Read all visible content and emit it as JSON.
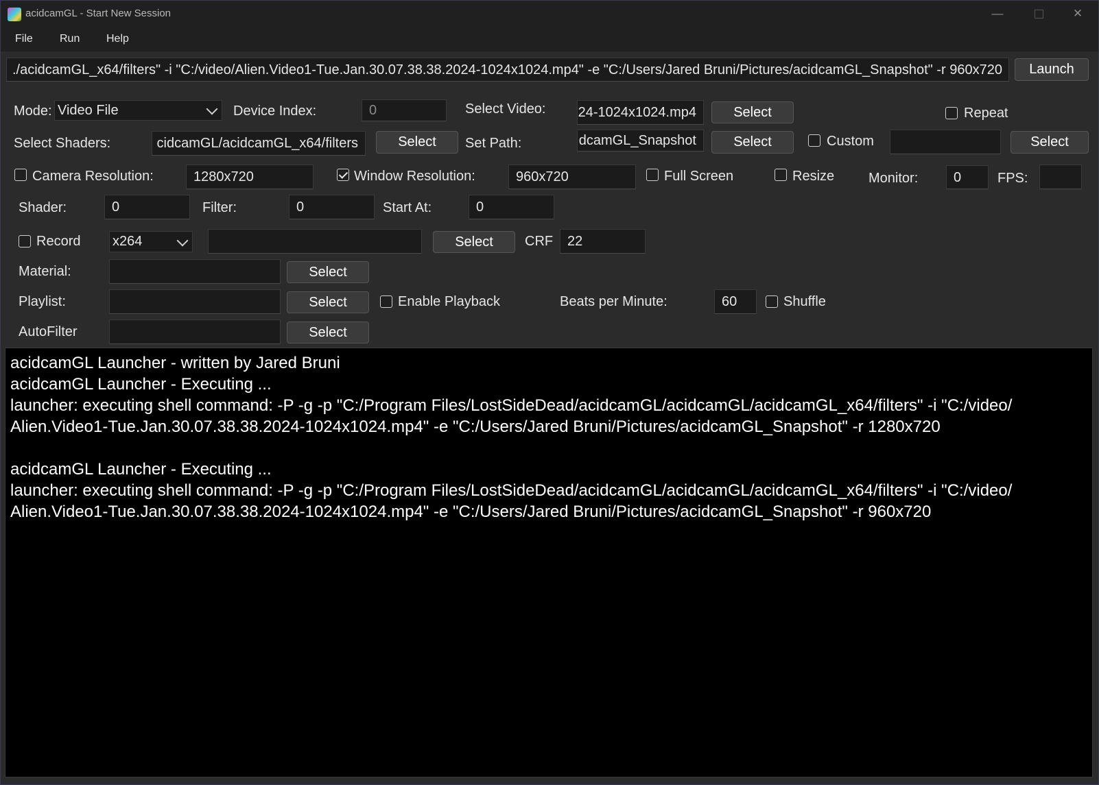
{
  "window": {
    "title": "acidcamGL - Start New Session",
    "minimize": "—",
    "close": "✕"
  },
  "menu": {
    "file": "File",
    "run": "Run",
    "help": "Help"
  },
  "command": {
    "value": "./acidcamGL_x64/filters\" -i \"C:/video/Alien.Video1-Tue.Jan.30.07.38.38.2024-1024x1024.mp4\" -e \"C:/Users/Jared Bruni/Pictures/acidcamGL_Snapshot\" -r 960x720",
    "launch_label": "Launch"
  },
  "row1": {
    "mode_label": "Mode:",
    "mode_value": "Video File",
    "device_index_label": "Device Index:",
    "device_index_value": "0",
    "select_video_label": "Select Video:",
    "select_video_value": "24-1024x1024.mp4",
    "select_label": "Select",
    "repeat_label": "Repeat"
  },
  "row2": {
    "select_shaders_label": "Select Shaders:",
    "shaders_value": "cidcamGL/acidcamGL_x64/filters",
    "select_label": "Select",
    "set_path_label": "Set Path:",
    "path_value": "dcamGL_Snapshot",
    "custom_label": "Custom",
    "custom_value": ""
  },
  "row3": {
    "camera_resolution_label": "Camera Resolution:",
    "camera_resolution_value": "1280x720",
    "window_resolution_label": "Window Resolution:",
    "window_resolution_value": "960x720",
    "full_screen_label": "Full Screen",
    "resize_label": "Resize",
    "monitor_label": "Monitor:",
    "monitor_value": "0",
    "fps_label": "FPS:",
    "fps_value": ""
  },
  "row4": {
    "shader_label": "Shader:",
    "shader_value": "0",
    "filter_label": "Filter:",
    "filter_value": "0",
    "start_at_label": "Start At:",
    "start_at_value": "0"
  },
  "row5": {
    "record_label": "Record",
    "codec_value": "x264",
    "record_path_value": "",
    "select_label": "Select",
    "crf_label": "CRF",
    "crf_value": "22"
  },
  "row6": {
    "material_label": "Material:",
    "material_value": "",
    "select_label": "Select"
  },
  "row7": {
    "playlist_label": "Playlist:",
    "playlist_value": "",
    "select_label": "Select",
    "enable_playback_label": "Enable Playback",
    "bpm_label": "Beats per Minute:",
    "bpm_value": "60",
    "shuffle_label": "Shuffle"
  },
  "row8": {
    "autofilter_label": "AutoFilter",
    "autofilter_value": "",
    "select_label": "Select"
  },
  "console": {
    "lines": [
      "acidcamGL Launcher - written by Jared Bruni",
      "acidcamGL Launcher - Executing ...",
      "launcher: executing shell command: -P -g -p \"C:/Program Files/LostSideDead/acidcamGL/acidcamGL/acidcamGL_x64/filters\" -i \"C:/video/",
      "Alien.Video1-Tue.Jan.30.07.38.38.2024-1024x1024.mp4\" -e \"C:/Users/Jared Bruni/Pictures/acidcamGL_Snapshot\" -r 1280x720",
      "",
      "acidcamGL Launcher - Executing ...",
      "launcher: executing shell command: -P -g -p \"C:/Program Files/LostSideDead/acidcamGL/acidcamGL/acidcamGL_x64/filters\" -i \"C:/video/",
      "Alien.Video1-Tue.Jan.30.07.38.38.2024-1024x1024.mp4\" -e \"C:/Users/Jared Bruni/Pictures/acidcamGL_Snapshot\" -r 960x720"
    ]
  }
}
